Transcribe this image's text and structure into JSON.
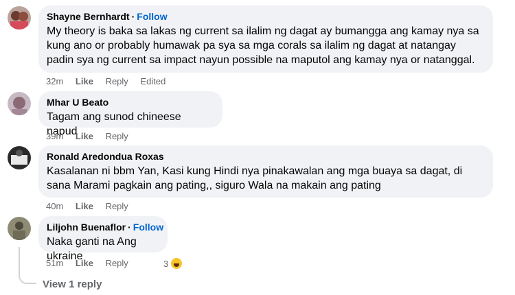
{
  "comments": [
    {
      "name": "Shayne Bernhardt",
      "separator": "·",
      "follow": "Follow",
      "text": "My theory is baka sa lakas ng current sa ilalim ng dagat ay bumangga ang kamay nya sa kung ano or probably humawak pa sya sa mga corals sa ilalim ng dagat at natangay padin sya ng current sa impact nayun possible na maputol ang kamay nya or natanggal.",
      "time": "32m",
      "like": "Like",
      "reply": "Reply",
      "edited": "Edited"
    },
    {
      "name": "Mhar U Beato",
      "text": "Tagam ang sunod chineese napud",
      "time": "39m",
      "like": "Like",
      "reply": "Reply"
    },
    {
      "name": "Ronald Aredondua Roxas",
      "text": "Kasalanan ni bbm Yan, Kasi kung Hindi nya pinakawalan ang mga buaya sa dagat, di sana Marami pagkain ang pating,, siguro Wala na makain ang pating",
      "time": "40m",
      "like": "Like",
      "reply": "Reply"
    },
    {
      "name": "Liljohn Buenaflor",
      "separator": "·",
      "follow": "Follow",
      "text": "Naka ganti na Ang ukraine",
      "time": "51m",
      "like": "Like",
      "reply": "Reply",
      "reaction_count": "3",
      "reaction_icon": "haha-emoji-icon"
    }
  ],
  "view_replies": "View 1 reply",
  "colors": {
    "bubble": "#f0f2f5",
    "follow": "#0064d1",
    "meta": "#65676b"
  }
}
